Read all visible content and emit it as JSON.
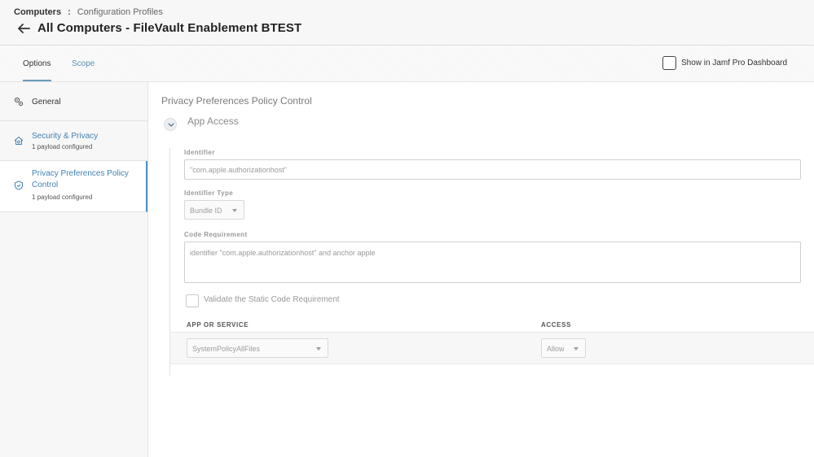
{
  "breadcrumb": {
    "root": "Computers",
    "separator": ":",
    "current": "Configuration Profiles"
  },
  "title": "All Computers - FileVault Enablement BTEST",
  "tabs": [
    {
      "label": "Options",
      "active": true
    },
    {
      "label": "Scope",
      "active": false
    }
  ],
  "dashboard": {
    "label": "Show in Jamf Pro Dashboard",
    "checked": false
  },
  "sidebar": {
    "items": [
      {
        "label": "General",
        "icon": "gears-icon"
      },
      {
        "label": "Security & Privacy",
        "sub": "1 payload configured",
        "icon": "house-shield-icon"
      },
      {
        "label": "Privacy Preferences Policy Control",
        "sub": "1 payload configured",
        "icon": "shield-icon",
        "selected": true
      }
    ]
  },
  "main": {
    "section_title": "Privacy Preferences Policy Control",
    "subsection_title": "App Access",
    "identifier": {
      "label": "Identifier",
      "value": "\"com.apple.authorizationhost\""
    },
    "identifier_type": {
      "label": "Identifier Type",
      "value": "Bundle ID"
    },
    "code_requirement": {
      "label": "Code Requirement",
      "value": "identifier \"com.apple.authorizationhost\" and anchor apple"
    },
    "validate": {
      "label": "Validate the Static Code Requirement",
      "checked": false
    },
    "table": {
      "headers": {
        "app": "APP OR SERVICE",
        "access": "ACCESS"
      },
      "rows": [
        {
          "app": "SystemPolicyAllFiles",
          "access": "Allow"
        }
      ]
    }
  },
  "colors": {
    "accent": "#3f82b2",
    "header_bg": "#f7f7f7",
    "sidebar_bg": "#f7f7f7"
  }
}
